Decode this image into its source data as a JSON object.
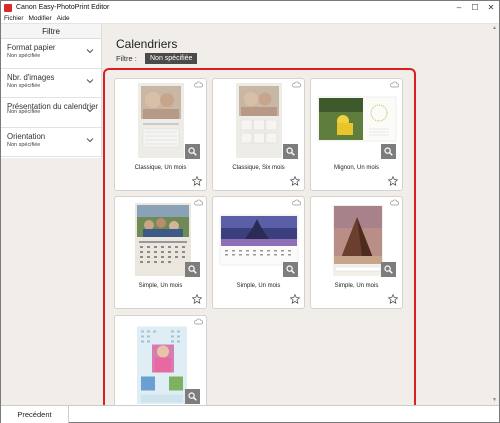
{
  "window": {
    "title": "Canon Easy-PhotoPrint Editor"
  },
  "menu": [
    "Fichier",
    "Modifier",
    "Aide"
  ],
  "sidebar": {
    "header": "Filtre",
    "filters": [
      {
        "title": "Format papier",
        "value": "Non spécifiée"
      },
      {
        "title": "Nbr. d'images",
        "value": "Non spécifiée"
      },
      {
        "title": "Présentation du calendrier",
        "value": "Non spécifiée"
      },
      {
        "title": "Orientation",
        "value": "Non spécifiée"
      }
    ]
  },
  "main": {
    "title": "Calendriers",
    "filter_label": "Filtre :",
    "filter_chip": "Non spécifiée"
  },
  "templates": [
    {
      "caption": "Classique, Un mois"
    },
    {
      "caption": "Classique, Six mois"
    },
    {
      "caption": "Mignon, Un mois"
    },
    {
      "caption": "Simple, Un mois"
    },
    {
      "caption": "Simple, Un mois"
    },
    {
      "caption": "Simple, Un mois"
    },
    {
      "caption": ""
    }
  ],
  "footer": {
    "back_label": "Precédent"
  },
  "colors": {
    "highlight": "#d92121",
    "chip_bg": "#4a4a4a",
    "zoom_bg": "#7d7d7d"
  }
}
